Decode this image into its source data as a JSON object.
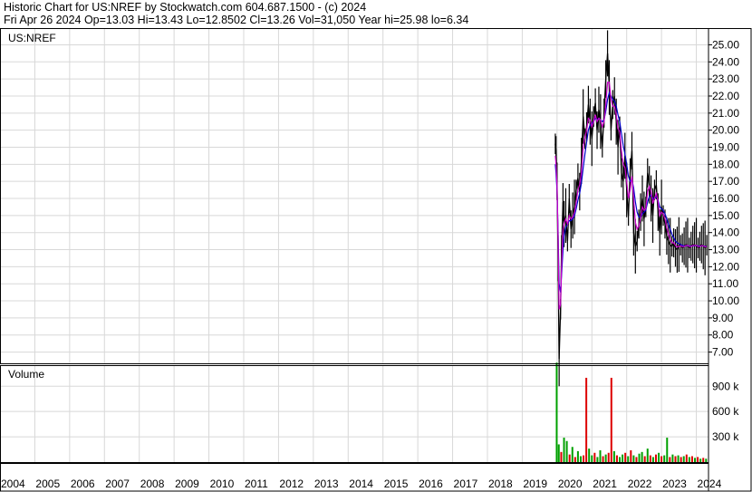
{
  "header": {
    "line1": "Historic Chart for US:NREF by Stockwatch.com 604.687.1500 - (c) 2024",
    "line2": "Fri Apr 26 2024  Op=13.03  Hi=13.43  Lo=12.8502  Cl=13.26  Vol=31,050  Year hi=25.98  lo=6.34"
  },
  "colors": {
    "price": "#000000",
    "ma_short": "#cc00cc",
    "ma_long": "#0000cc",
    "volume_up": "#00a000",
    "volume_down": "#dd0000",
    "grid": "#d8d8d8",
    "frame": "#000000"
  },
  "chart_data": {
    "type": "line",
    "series_label": "US:NREF",
    "x_years": [
      "2004",
      "2005",
      "2006",
      "2007",
      "2008",
      "2009",
      "2010",
      "2011",
      "2012",
      "2013",
      "2014",
      "2015",
      "2016",
      "2017",
      "2018",
      "2019",
      "2020",
      "2021",
      "2022",
      "2023",
      "2024"
    ],
    "y_ticks": [
      "25.00",
      "24.00",
      "23.00",
      "22.00",
      "21.00",
      "20.00",
      "19.00",
      "18.00",
      "17.00",
      "16.00",
      "15.00",
      "14.00",
      "13.00",
      "12.00",
      "11.00",
      "10.00",
      "9.00",
      "8.00",
      "7.00"
    ],
    "ylim": [
      6.34,
      25.98
    ],
    "price_series": {
      "name": "Close",
      "x": [
        2019.95,
        2019.97,
        2020.0,
        2020.03,
        2020.06,
        2020.1,
        2020.13,
        2020.17,
        2020.2,
        2020.25,
        2020.3,
        2020.35,
        2020.4,
        2020.45,
        2020.5,
        2020.55,
        2020.6,
        2020.65,
        2020.7,
        2020.75,
        2020.8,
        2020.85,
        2020.9,
        2020.95,
        2021.0,
        2021.05,
        2021.1,
        2021.15,
        2021.2,
        2021.25,
        2021.3,
        2021.35,
        2021.4,
        2021.45,
        2021.5,
        2021.55,
        2021.6,
        2021.65,
        2021.7,
        2021.75,
        2021.8,
        2021.85,
        2021.9,
        2021.95,
        2022.0,
        2022.05,
        2022.1,
        2022.15,
        2022.2,
        2022.25,
        2022.3,
        2022.35,
        2022.4,
        2022.45,
        2022.5,
        2022.55,
        2022.6,
        2022.65,
        2022.7,
        2022.75,
        2022.8,
        2022.85,
        2022.9,
        2022.95,
        2023.0,
        2023.05,
        2023.1,
        2023.15,
        2023.2,
        2023.25,
        2023.3,
        2023.35,
        2023.4,
        2023.45,
        2023.5,
        2023.55,
        2023.6,
        2023.65,
        2023.7,
        2023.75,
        2023.8,
        2023.85,
        2023.9,
        2023.95,
        2024.0,
        2024.05,
        2024.1,
        2024.15,
        2024.2,
        2024.25,
        2024.3
      ],
      "y": [
        19.2,
        18.8,
        17.0,
        12.5,
        6.6,
        9.5,
        13.0,
        15.8,
        14.5,
        15.0,
        13.5,
        16.0,
        14.2,
        15.0,
        15.5,
        16.5,
        17.2,
        16.4,
        18.2,
        20.8,
        19.5,
        20.2,
        21.5,
        20.5,
        19.5,
        20.8,
        21.6,
        20.0,
        21.2,
        20.5,
        19.0,
        21.0,
        23.0,
        24.5,
        22.5,
        20.0,
        21.5,
        22.0,
        20.5,
        19.0,
        20.2,
        17.5,
        17.0,
        18.5,
        16.5,
        15.0,
        17.5,
        18.8,
        14.0,
        13.2,
        13.5,
        14.5,
        15.2,
        16.0,
        14.8,
        15.5,
        17.5,
        16.8,
        16.0,
        15.0,
        16.5,
        16.8,
        15.2,
        14.0,
        15.5,
        15.0,
        14.5,
        13.8,
        13.5,
        13.26,
        13.2,
        13.4,
        13.1,
        13.0,
        13.3,
        13.26,
        13.1,
        13.2,
        13.3,
        13.26,
        13.1,
        13.2,
        13.3,
        13.26,
        13.26,
        13.1,
        13.2,
        13.3,
        13.2,
        13.1,
        13.26
      ]
    },
    "ma_short": {
      "name": "",
      "y": [
        18.5,
        18.0,
        16.8,
        13.5,
        9.5,
        9.8,
        12.0,
        14.2,
        14.5,
        14.8,
        14.5,
        15.0,
        14.8,
        14.9,
        15.2,
        15.8,
        16.5,
        16.8,
        17.5,
        19.0,
        19.6,
        20.0,
        20.7,
        20.6,
        20.2,
        20.5,
        20.9,
        20.5,
        20.7,
        20.6,
        20.2,
        20.5,
        21.5,
        22.8,
        22.8,
        21.8,
        21.4,
        21.4,
        20.9,
        20.1,
        19.9,
        18.8,
        18.0,
        17.8,
        17.0,
        16.0,
        16.5,
        17.3,
        16.0,
        14.6,
        14.2,
        14.4,
        14.9,
        15.5,
        15.3,
        15.4,
        16.4,
        16.7,
        16.4,
        15.7,
        16.0,
        16.3,
        15.8,
        15.0,
        15.2,
        15.1,
        14.8,
        14.3,
        13.9,
        13.6,
        13.4,
        13.4,
        13.25,
        13.15,
        13.2,
        13.22,
        13.18,
        13.19,
        13.24,
        13.25,
        13.18,
        13.19,
        13.24,
        13.25,
        13.25,
        13.18,
        13.19,
        13.24,
        13.22,
        13.16,
        13.2
      ]
    },
    "ma_long": {
      "name": "",
      "y": [
        18.0,
        17.5,
        16.5,
        14.0,
        11.0,
        10.5,
        11.5,
        13.0,
        13.8,
        14.3,
        14.5,
        14.7,
        14.7,
        14.8,
        15.0,
        15.4,
        15.9,
        16.3,
        16.9,
        17.8,
        18.6,
        19.3,
        20.0,
        20.3,
        20.4,
        20.5,
        20.7,
        20.6,
        20.7,
        20.6,
        20.5,
        20.6,
        21.1,
        21.8,
        22.2,
        22.0,
        21.8,
        21.7,
        21.4,
        20.9,
        20.5,
        19.8,
        19.1,
        18.6,
        18.0,
        17.3,
        17.0,
        17.1,
        16.6,
        15.8,
        15.2,
        14.9,
        14.9,
        15.1,
        15.2,
        15.3,
        15.8,
        16.1,
        16.2,
        16.0,
        16.0,
        16.1,
        15.9,
        15.5,
        15.4,
        15.3,
        15.1,
        14.8,
        14.5,
        14.2,
        13.9,
        13.7,
        13.5,
        13.4,
        13.35,
        13.3,
        13.25,
        13.22,
        13.22,
        13.23,
        13.22,
        13.21,
        13.22,
        13.23,
        13.23,
        13.22,
        13.21,
        13.22,
        13.22,
        13.2,
        13.2
      ]
    },
    "volume_panel": {
      "label": "Volume",
      "ticks": [
        "900 k",
        "600 k",
        "300 k"
      ],
      "ylim": [
        0,
        1150000
      ],
      "x": [
        2019.99,
        2020.05,
        2020.12,
        2020.2,
        2020.28,
        2020.36,
        2020.44,
        2020.52,
        2020.6,
        2020.68,
        2020.76,
        2020.84,
        2020.92,
        2021.0,
        2021.08,
        2021.16,
        2021.24,
        2021.32,
        2021.4,
        2021.48,
        2021.56,
        2021.64,
        2021.72,
        2021.8,
        2021.88,
        2021.96,
        2022.04,
        2022.12,
        2022.2,
        2022.28,
        2022.36,
        2022.44,
        2022.52,
        2022.6,
        2022.68,
        2022.76,
        2022.84,
        2022.92,
        2023.0,
        2023.08,
        2023.16,
        2023.24,
        2023.32,
        2023.4,
        2023.48,
        2023.56,
        2023.64,
        2023.72,
        2023.8,
        2023.88,
        2023.96,
        2024.04,
        2024.12,
        2024.2,
        2024.28
      ],
      "values": [
        1180000,
        210000,
        120000,
        290000,
        250000,
        90000,
        180000,
        60000,
        130000,
        70000,
        80000,
        1000000,
        160000,
        80000,
        110000,
        60000,
        140000,
        70000,
        90000,
        110000,
        1000000,
        130000,
        80000,
        60000,
        90000,
        110000,
        70000,
        140000,
        80000,
        60000,
        100000,
        120000,
        70000,
        160000,
        80000,
        60000,
        90000,
        110000,
        70000,
        80000,
        290000,
        60000,
        90000,
        70000,
        80000,
        60000,
        70000,
        90000,
        60000,
        70000,
        50000,
        60000,
        40000,
        50000,
        40000
      ],
      "up": [
        true,
        true,
        false,
        true,
        true,
        false,
        true,
        false,
        true,
        true,
        false,
        false,
        true,
        true,
        false,
        true,
        true,
        false,
        true,
        false,
        false,
        true,
        false,
        true,
        true,
        false,
        true,
        false,
        true,
        false,
        true,
        true,
        false,
        true,
        false,
        true,
        false,
        true,
        false,
        true,
        true,
        false,
        true,
        false,
        true,
        false,
        true,
        false,
        true,
        false,
        true,
        false,
        true,
        false,
        true
      ]
    }
  }
}
